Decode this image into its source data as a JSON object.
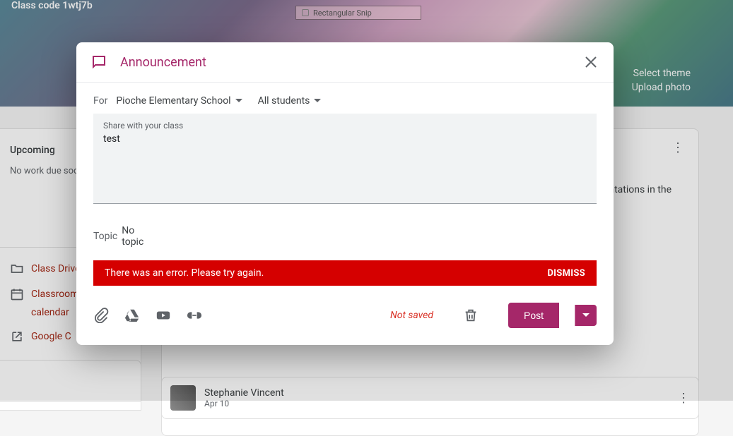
{
  "bg": {
    "classcode": "Class code 1wtj7b",
    "snip": "Rectangular Snip",
    "select_theme": "Select theme",
    "upload_photo": "Upload photo",
    "upcoming": "Upcoming",
    "nowork": "No work due soon",
    "link_drive": "Class Drive",
    "link_cal": "Classroom",
    "link_cal2": "calendar",
    "link_gc": "Google C",
    "fragment": "ntations in the",
    "post_name": "Stephanie Vincent",
    "post_date": "Apr 10"
  },
  "dialog": {
    "title": "Announcement",
    "for_label": "For",
    "class_name": "Pioche Elementary School",
    "students": "All students",
    "placeholder": "Share with your class",
    "content": "test",
    "topic_label": "Topic",
    "topic_value": "No topic",
    "error": "There was an error. Please try again.",
    "dismiss": "DISMISS",
    "not_saved": "Not saved",
    "post": "Post"
  }
}
